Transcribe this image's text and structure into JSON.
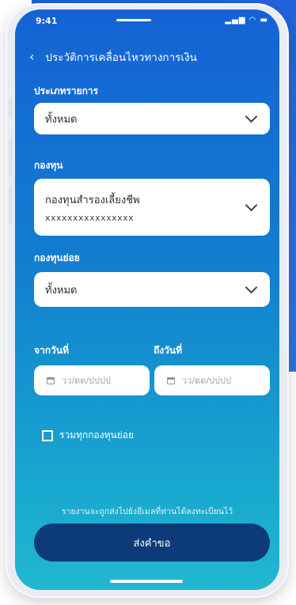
{
  "status": {
    "time": "9:41",
    "icons": "..ıl ᯤ ▬"
  },
  "header": {
    "title": "ประวัติการเคลื่อนไหวทางการเงิน"
  },
  "transaction_type": {
    "label": "ประเภทรายการ",
    "value": "ทั้งหมด"
  },
  "fund": {
    "label": "กองทุน",
    "value": "กองทุนสำรองเลี้ยงชีพ",
    "code": "xxxxxxxxxxxxxxxx"
  },
  "sub_fund": {
    "label": "กองทุนย่อย",
    "value": "ทั้งหมด"
  },
  "date_from": {
    "label": "จากวันที่",
    "placeholder": "วว/ดด/ปปปป"
  },
  "date_to": {
    "label": "ถึงวันที่",
    "placeholder": "วว/ดด/ปปปป"
  },
  "combine_checkbox": {
    "label": "รวมทุกกองทุนย่อย",
    "checked": false
  },
  "notice": "รายงานจะถูกส่งไปยังอีเมลที่ท่านได้ลงทะเบียนไว้",
  "submit_label": "ส่งคำขอ"
}
